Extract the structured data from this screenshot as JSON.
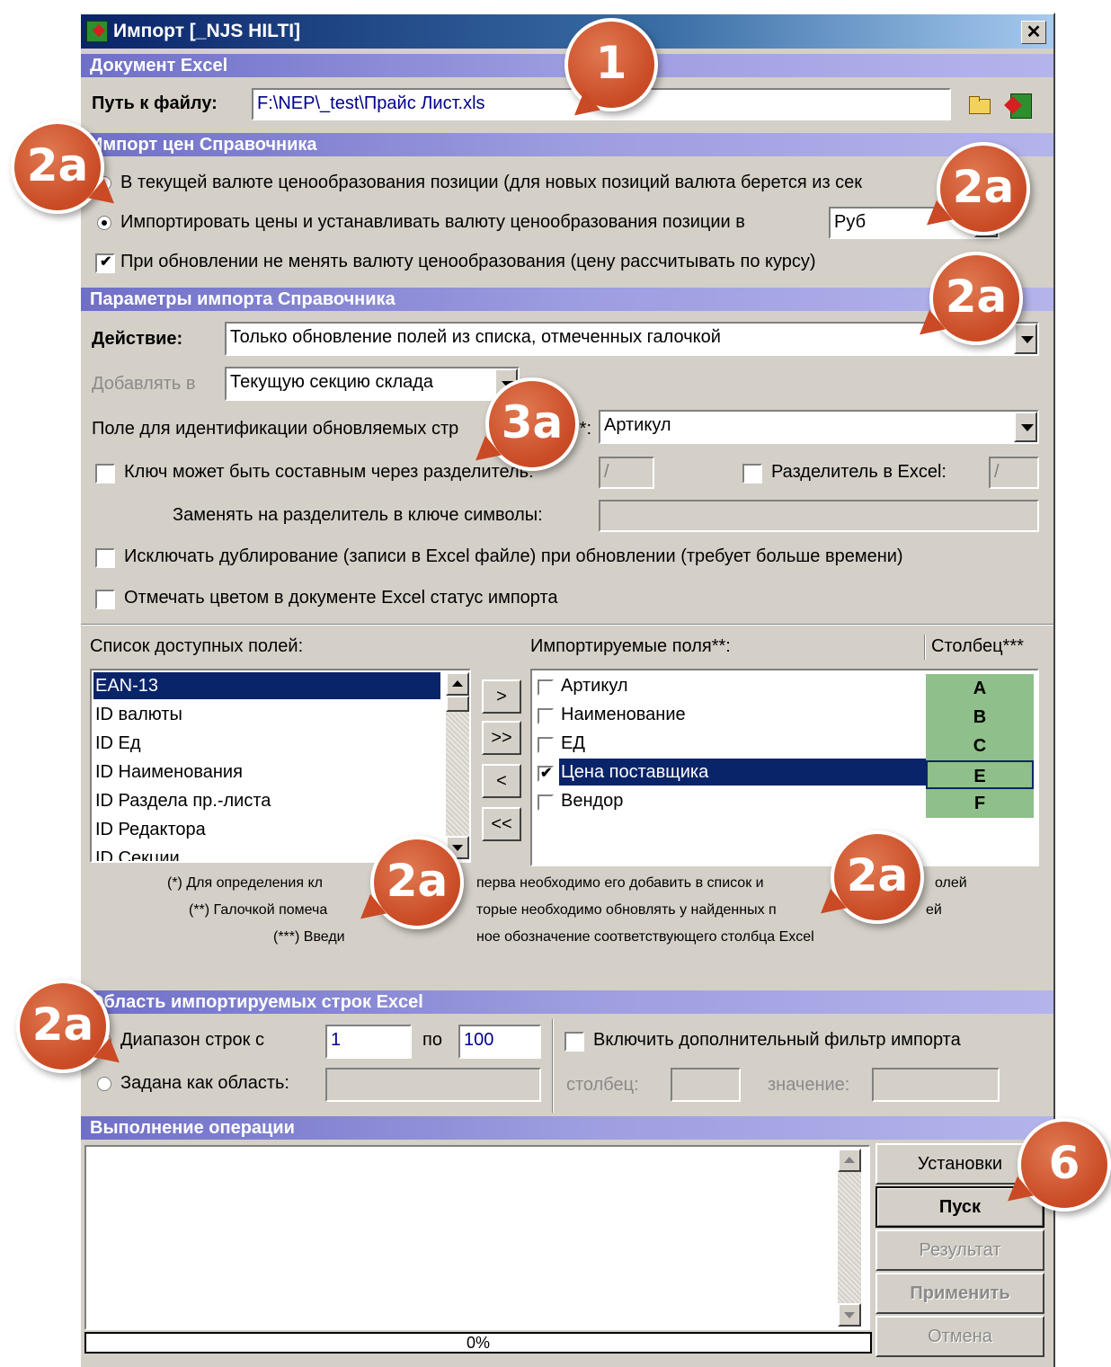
{
  "window": {
    "title": "Импорт [_NJS HILTI]",
    "close_label": "✕"
  },
  "excel_doc": {
    "header": "Документ Excel",
    "path_label": "Путь к файлу:",
    "path_value": "F:\\NEP\\_test\\Прайс Лист.xls"
  },
  "price_import": {
    "header": "Импорт цен Справочника",
    "radio_current": "В текущей валюте ценообразования позиции (для новых позиций валюта берется из сек",
    "radio_set": "Импортировать цены и устанавливать валюту ценообразования позиции в",
    "currency": "Руб",
    "keep_currency": "При обновлении не менять валюту ценообразования (цену рассчитывать по курсу)"
  },
  "params": {
    "header": "Параметры импорта Справочника",
    "action_label": "Действие:",
    "action_value": "Только обновление полей из списка, отмеченных галочкой",
    "add_to_label": "Добавлять в",
    "add_to_value": "Текущую секцию склада",
    "id_field_label": "Поле для идентификации обновляемых стр",
    "id_field_suffix": ")*:",
    "id_field_value": "Артикул",
    "composite_key_label": "Ключ может быть составным через разделитель:",
    "composite_key_value": "/",
    "excel_sep_label": "Разделитель в Excel:",
    "excel_sep_value": "/",
    "replace_label": "Заменять на разделитель в ключе символы:",
    "exclude_dup_label": "Исключать дублирование (записи в Excel файле) при обновлении (требует больше времени)",
    "mark_color_label": "Отмечать цветом в документе Excel статус импорта"
  },
  "fields": {
    "available_label": "Список доступных полей:",
    "imported_label": "Импортируемые поля**:",
    "column_label": "Столбец***",
    "available": [
      "EAN-13",
      "ID валюты",
      "ID Ед",
      "ID Наименования",
      "ID Раздела пр.-листа",
      "ID Редактора",
      "ID Секции"
    ],
    "btn_add": ">",
    "btn_add_all": ">>",
    "btn_remove": "<",
    "btn_remove_all": "<<",
    "imported": [
      {
        "name": "Артикул",
        "column": "A"
      },
      {
        "name": "Наименование",
        "column": "B"
      },
      {
        "name": "ЕД",
        "column": "C"
      },
      {
        "name": "Цена поставщика",
        "column": "E"
      },
      {
        "name": "Вендор",
        "column": "F"
      }
    ],
    "foot1a": "(*)  Для определения кл",
    "foot1b": "перва необходимо его добавить в список и",
    "foot1c": "олей",
    "foot2a": "(**)  Галочкой помеча",
    "foot2b": "торые необходимо обновлять у найденных п",
    "foot2c": "ей",
    "foot3a": "(***)  Введи",
    "foot3b": "ное обозначение соответствующего столбца Excel"
  },
  "rows_area": {
    "header": "Область импортируемых строк Excel",
    "range_label": "Диапазон строк с",
    "range_from": "1",
    "range_to_label": "по",
    "range_to": "100",
    "area_label": "Задана как область:",
    "filter_label": "Включить дополнительный фильтр импорта",
    "filter_col_label": "столбец:",
    "filter_val_label": "значение:"
  },
  "execution": {
    "header": "Выполнение операции",
    "progress": "0%",
    "btn_settings": "Установки",
    "btn_start": "Пуск",
    "btn_result": "Результат",
    "btn_apply": "Применить",
    "btn_cancel": "Отмена"
  },
  "callouts": {
    "c1": "1",
    "c2a": "2a",
    "c3a": "3a",
    "c6": "6"
  }
}
